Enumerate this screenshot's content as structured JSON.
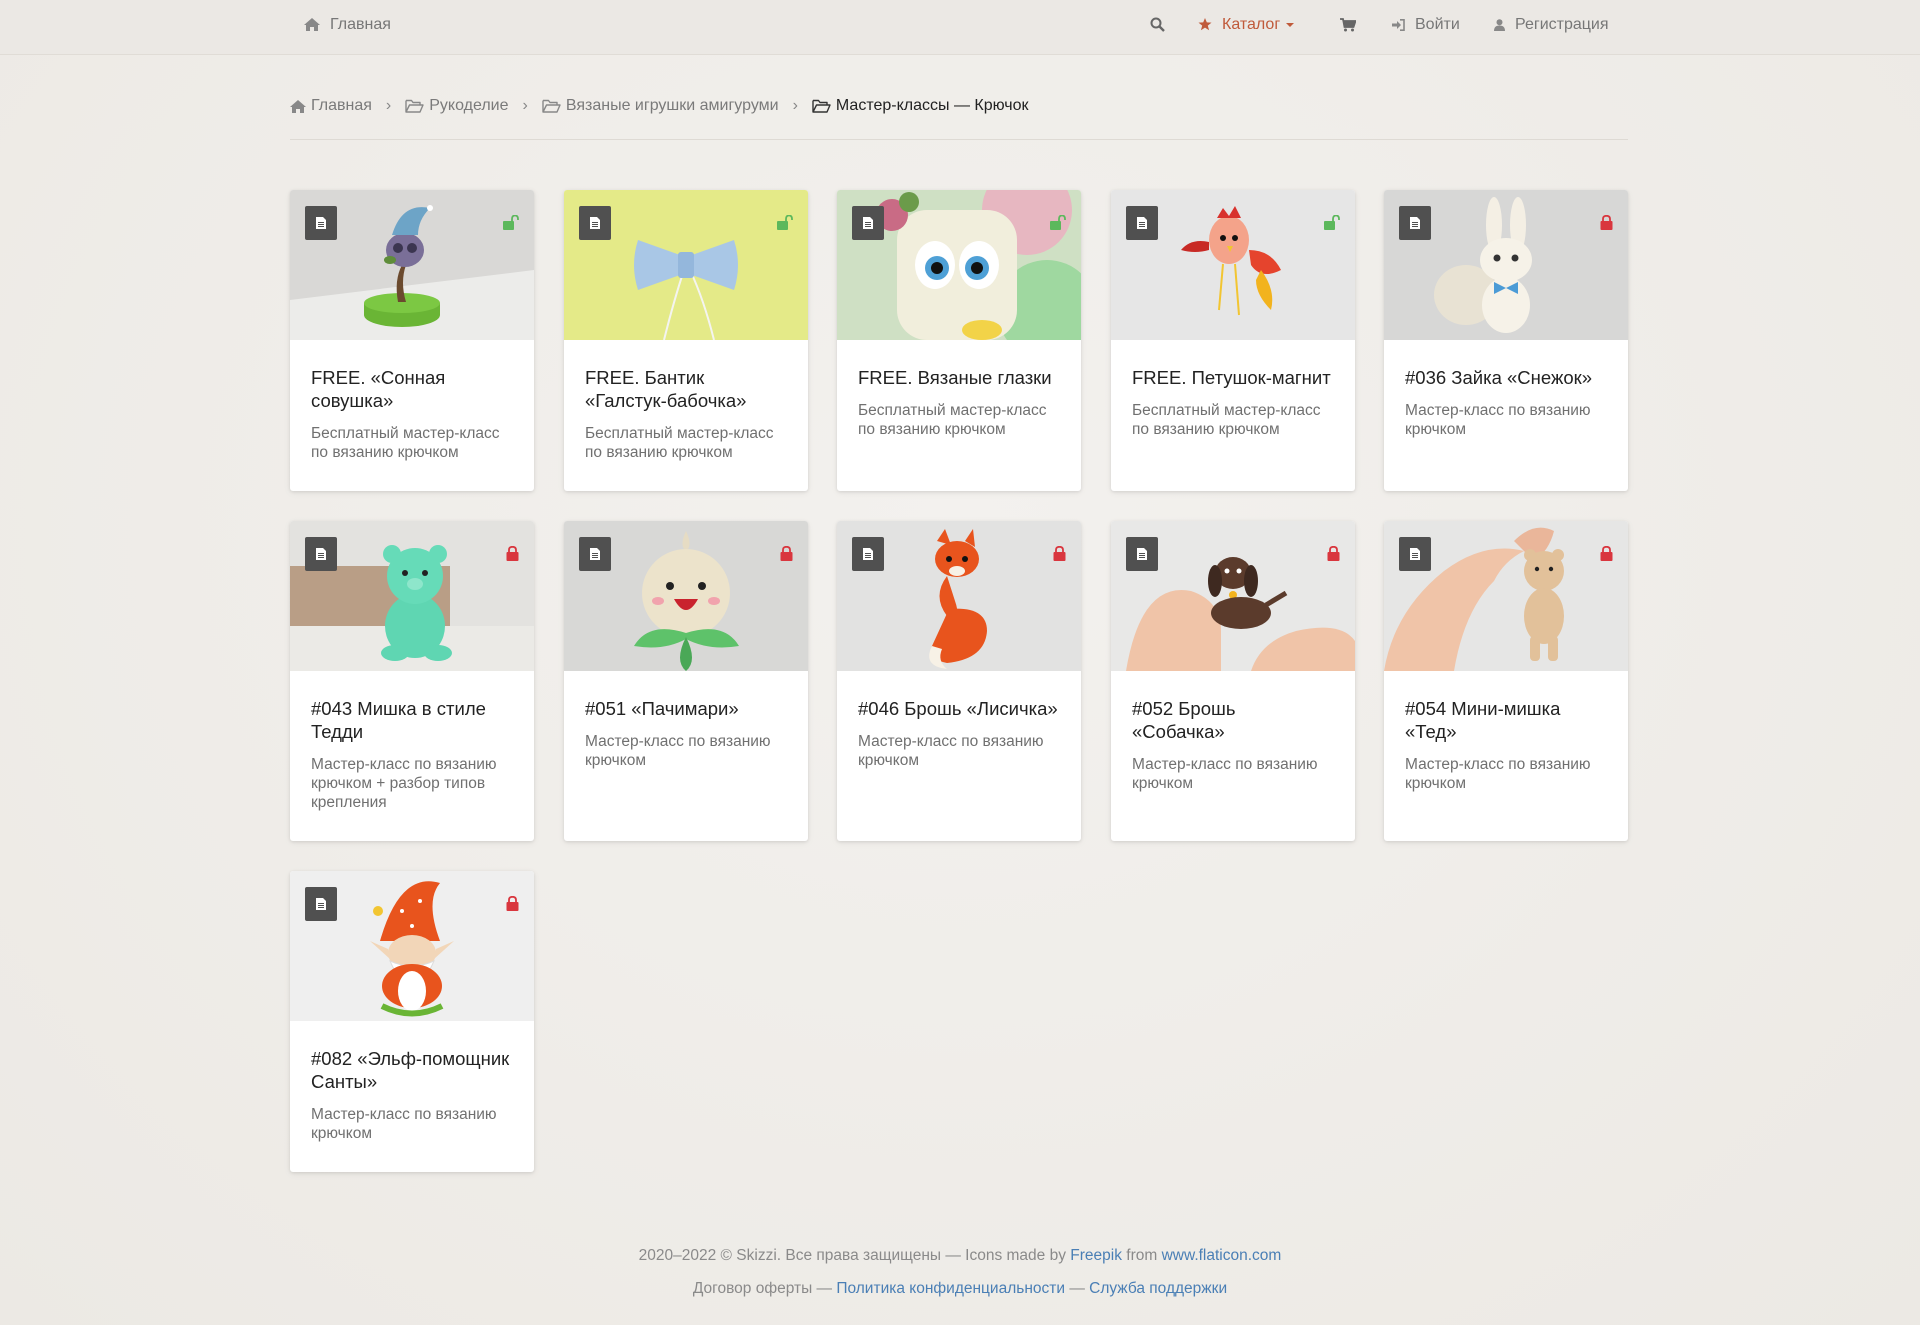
{
  "navbar": {
    "home_label": "Главная",
    "catalog_label": "Каталог",
    "login_label": "Войти",
    "register_label": "Регистрация",
    "icons": [
      "home-icon",
      "search-icon",
      "star-icon",
      "cart-icon",
      "sign-in-icon",
      "user-icon"
    ],
    "accent_color": "#c05a3a"
  },
  "breadcrumb": {
    "items": [
      {
        "label": "Главная",
        "icon": "home-icon"
      },
      {
        "label": "Рукоделие",
        "icon": "folder-open-icon"
      },
      {
        "label": "Вязаные игрушки амигуруми",
        "icon": "folder-open-icon"
      },
      {
        "label": "Мастер-классы — Крючок",
        "icon": "folder-open-icon"
      }
    ],
    "separator": "›"
  },
  "cards": [
    {
      "title": "FREE. «Сонная совушка»",
      "desc": "Бесплатный мастер-класс по вязанию крючком",
      "locked": false,
      "image": "owl on a tree"
    },
    {
      "title": "FREE. Бантик «Галстук-бабочка»",
      "desc": "Бесплатный мастер-класс по вязанию крючком",
      "locked": false,
      "image": "blue bow tie"
    },
    {
      "title": "FREE. Вязаные глазки",
      "desc": "Бесплатный мастер-класс по вязанию крючком",
      "locked": false,
      "image": "toy with big eyes"
    },
    {
      "title": "FREE. Петушок-магнит",
      "desc": "Бесплатный мастер-класс по вязанию крючком",
      "locked": false,
      "image": "rooster magnet"
    },
    {
      "title": "#036 Зайка «Снежок»",
      "desc": "Мастер-класс по вязанию крючком",
      "locked": true,
      "image": "white bunny"
    },
    {
      "title": "#043 Мишка в стиле Тедди",
      "desc": "Мастер-класс по вязанию крючком + разбор типов крепления",
      "locked": true,
      "image": "mint teddy bear"
    },
    {
      "title": "#051 «Пачимари»",
      "desc": "Мастер-класс по вязанию крючком",
      "locked": true,
      "image": "pachimari onion"
    },
    {
      "title": "#046 Брошь «Лисичка»",
      "desc": "Мастер-класс по вязанию крючком",
      "locked": true,
      "image": "fox brooch"
    },
    {
      "title": "#052 Брошь «Собачка»",
      "desc": "Мастер-класс по вязанию крючком",
      "locked": true,
      "image": "dog brooch in hand"
    },
    {
      "title": "#054 Мини-мишка «Тед»",
      "desc": "Мастер-класс по вязанию крючком",
      "locked": true,
      "image": "mini bear in hand"
    },
    {
      "title": "#082 «Эльф-помощник Санты»",
      "desc": "Мастер-класс по вязанию крючком",
      "locked": true,
      "image": "santa elf gnome"
    }
  ],
  "colors": {
    "unlocked": "#5cb85c",
    "locked": "#d9363e",
    "link": "#4a7fb5"
  },
  "footer": {
    "copyright": "2020–2022 © Skizzi. Все права защищены — Icons made by",
    "freepik": "Freepik",
    "from": "from",
    "flaticon": "www.flaticon.com",
    "offer": "Договор оферты —",
    "privacy": "Политика конфиденциальности",
    "dash": "—",
    "support": "Служба поддержки"
  }
}
